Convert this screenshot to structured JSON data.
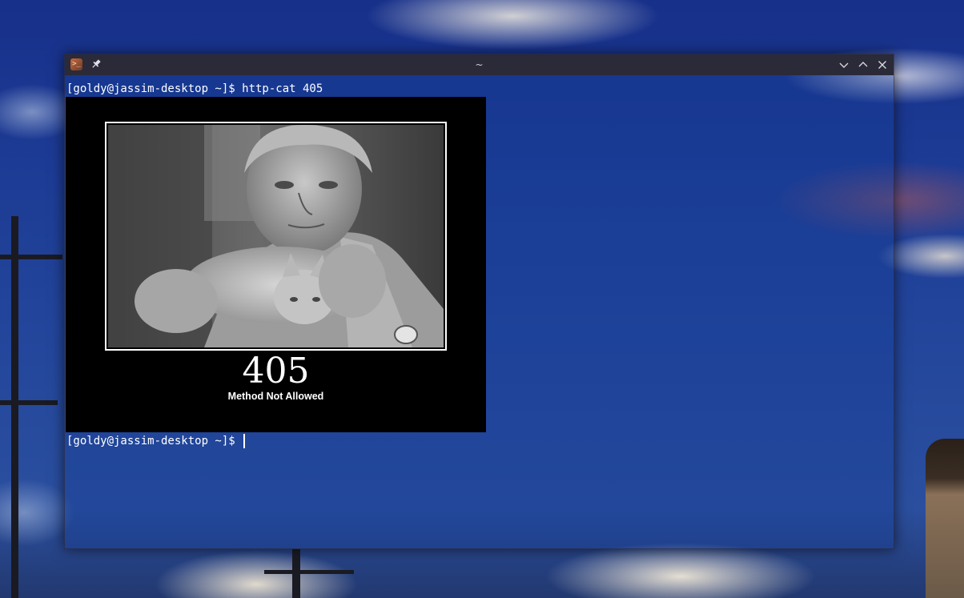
{
  "desktop": {
    "wallpaper": "anime-sky-wallpaper"
  },
  "window": {
    "title": "~",
    "app_icon": "terminal-app-icon",
    "pin_icon": "pin-icon",
    "controls": [
      "minimize-icon",
      "maximize-icon",
      "close-icon"
    ]
  },
  "terminal": {
    "line1": "[goldy@jassim-desktop ~]$ http-cat 405",
    "line2": "[goldy@jassim-desktop ~]$ ",
    "image": {
      "code": "405",
      "message": "Method Not Allowed"
    }
  },
  "colors": {
    "titlebar": "#2a2a38",
    "terminal_text": "#ffffff",
    "poster_bg": "#000000"
  }
}
